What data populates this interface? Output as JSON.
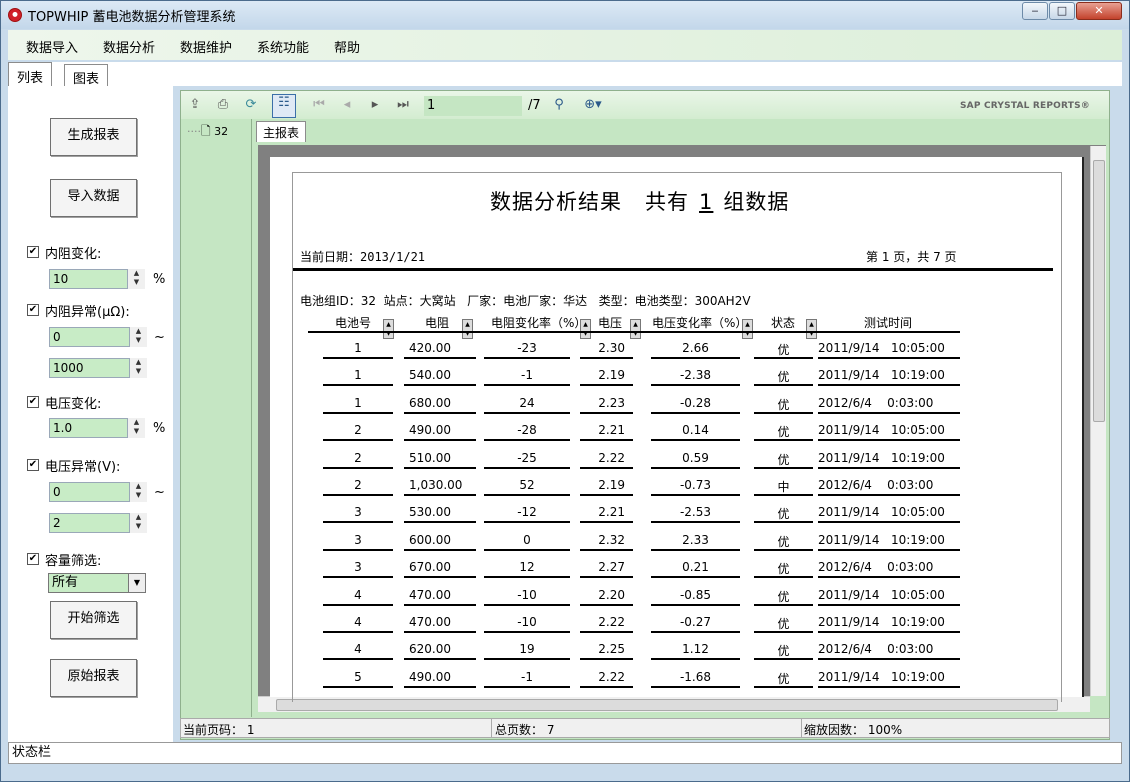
{
  "window": {
    "title": "TOPWHIP 蓄电池数据分析管理系统",
    "min_label": "‒",
    "max_label": "□",
    "close_label": "✕"
  },
  "menu": [
    "数据导入",
    "数据分析",
    "数据维护",
    "系统功能",
    "帮助"
  ],
  "tabs": [
    "列表",
    "图表"
  ],
  "left": {
    "btn_generate": "生成报表",
    "btn_import": "导入数据",
    "resistance_change": {
      "label": "内阻变化:",
      "value": "10",
      "unit": "%"
    },
    "resistance_abnormal": {
      "label": "内阻异常(μΩ):",
      "min": "0",
      "max": "1000",
      "sep": "~"
    },
    "voltage_change": {
      "label": "电压变化:",
      "value": "1.0",
      "unit": "%"
    },
    "voltage_abnormal": {
      "label": "电压异常(V):",
      "min": "0",
      "max": "2",
      "sep": "~"
    },
    "capacity": {
      "label": "容量筛选:",
      "value": "所有"
    },
    "btn_filter": "开始筛选",
    "btn_original": "原始报表"
  },
  "viewer": {
    "page_value": "1",
    "page_total": "/7",
    "brand": "SAP CRYSTAL REPORTS®",
    "tree_node": "32",
    "main_tab": "主报表"
  },
  "report": {
    "title_prefix": "数据分析结果   共有",
    "group_count": "1",
    "title_suffix": "组数据",
    "date": "当前日期：2013/1/21",
    "page_info": "第 1 页，共 7 页",
    "info": "电池组ID：32  站点：大窝站   厂家：电池厂家：华达   类型：电池类型：300AH2V",
    "headers": [
      "电池号",
      "电阻",
      "电阻变化率（%）",
      "电压",
      "电压变化率（%）",
      "状态",
      "测试时间"
    ],
    "rows": [
      [
        "1",
        "420.00",
        "-23",
        "2.30",
        "2.66",
        "优",
        "2011/9/14   10:05:00"
      ],
      [
        "1",
        "540.00",
        "-1",
        "2.19",
        "-2.38",
        "优",
        "2011/9/14   10:19:00"
      ],
      [
        "1",
        "680.00",
        "24",
        "2.23",
        "-0.28",
        "优",
        "2012/6/4    0:03:00"
      ],
      [
        "2",
        "490.00",
        "-28",
        "2.21",
        "0.14",
        "优",
        "2011/9/14   10:05:00"
      ],
      [
        "2",
        "510.00",
        "-25",
        "2.22",
        "0.59",
        "优",
        "2011/9/14   10:19:00"
      ],
      [
        "2",
        "1,030.00",
        "52",
        "2.19",
        "-0.73",
        "中",
        "2012/6/4    0:03:00"
      ],
      [
        "3",
        "530.00",
        "-12",
        "2.21",
        "-2.53",
        "优",
        "2011/9/14   10:05:00"
      ],
      [
        "3",
        "600.00",
        "0",
        "2.32",
        "2.33",
        "优",
        "2011/9/14   10:19:00"
      ],
      [
        "3",
        "670.00",
        "12",
        "2.27",
        "0.21",
        "优",
        "2012/6/4    0:03:00"
      ],
      [
        "4",
        "470.00",
        "-10",
        "2.20",
        "-0.85",
        "优",
        "2011/9/14   10:05:00"
      ],
      [
        "4",
        "470.00",
        "-10",
        "2.22",
        "-0.27",
        "优",
        "2011/9/14   10:19:00"
      ],
      [
        "4",
        "620.00",
        "19",
        "2.25",
        "1.12",
        "优",
        "2012/6/4    0:03:00"
      ],
      [
        "5",
        "490.00",
        "-1",
        "2.22",
        "-1.68",
        "优",
        "2011/9/14   10:19:00"
      ]
    ]
  },
  "statusbar": {
    "current_page": "当前页码：  1",
    "total_pages": "总页数：  7",
    "zoom": "缩放因数：  100%",
    "bottom": "状态栏"
  }
}
